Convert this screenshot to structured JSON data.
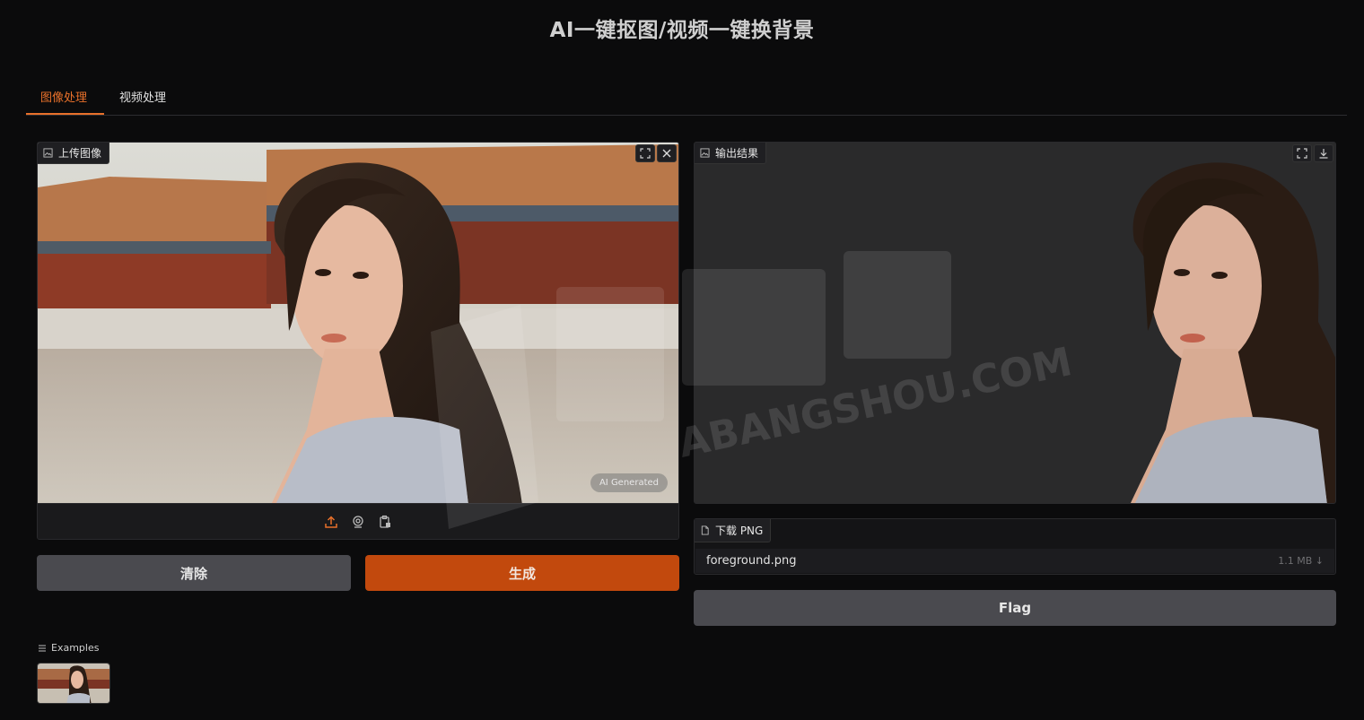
{
  "app": {
    "title": "AI一键抠图/视频一键换背景"
  },
  "tabs": [
    {
      "label": "图像处理",
      "active": true
    },
    {
      "label": "视频处理",
      "active": false
    }
  ],
  "input_panel": {
    "label": "上传图像",
    "label_icon": "image-icon",
    "fullscreen_icon": "fullscreen-icon",
    "close_icon": "close-icon",
    "badge": "AI Generated",
    "sources": [
      "upload-icon",
      "webcam-icon",
      "clipboard-icon"
    ]
  },
  "output_panel": {
    "label": "输出结果",
    "label_icon": "image-icon",
    "fullscreen_icon": "fullscreen-icon",
    "download_icon": "download-icon"
  },
  "buttons": {
    "clear": "清除",
    "generate": "生成",
    "flag": "Flag"
  },
  "download_file": {
    "label": "下载 PNG",
    "label_icon": "file-icon",
    "filename": "foreground.png",
    "size": "1.1 MB ↓"
  },
  "examples": {
    "label": "Examples",
    "icon": "list-icon"
  },
  "colors": {
    "background": "#0b0b0c",
    "accent": "#e8702a",
    "primary_button": "#c2490d",
    "secondary_button": "#4a4a4f"
  }
}
